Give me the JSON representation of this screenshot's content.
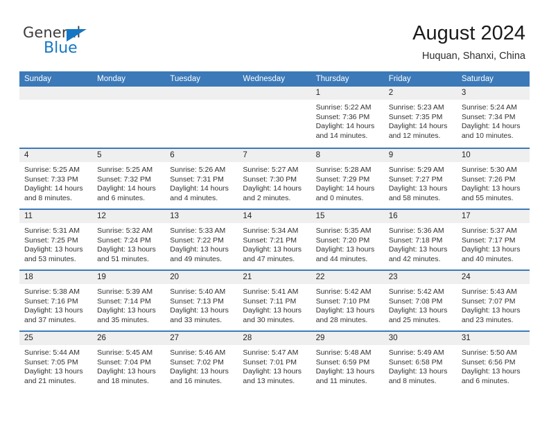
{
  "brand": {
    "name_top": "General",
    "name_bottom": "Blue",
    "triangle_color": "#1577c4"
  },
  "header": {
    "title": "August 2024",
    "location": "Huquan, Shanxi, China",
    "accent_color": "#3b79b8",
    "day_band_color": "#efefef"
  },
  "calendar": {
    "weekday_headers": [
      "Sunday",
      "Monday",
      "Tuesday",
      "Wednesday",
      "Thursday",
      "Friday",
      "Saturday"
    ],
    "labels": {
      "sunrise": "Sunrise:",
      "sunset": "Sunset:",
      "daylight": "Daylight:"
    },
    "weeks": [
      [
        {
          "day": "",
          "empty": true
        },
        {
          "day": "",
          "empty": true
        },
        {
          "day": "",
          "empty": true
        },
        {
          "day": "",
          "empty": true
        },
        {
          "day": "1",
          "sunrise": "Sunrise: 5:22 AM",
          "sunset": "Sunset: 7:36 PM",
          "daylight_l1": "Daylight: 14 hours",
          "daylight_l2": "and 14 minutes."
        },
        {
          "day": "2",
          "sunrise": "Sunrise: 5:23 AM",
          "sunset": "Sunset: 7:35 PM",
          "daylight_l1": "Daylight: 14 hours",
          "daylight_l2": "and 12 minutes."
        },
        {
          "day": "3",
          "sunrise": "Sunrise: 5:24 AM",
          "sunset": "Sunset: 7:34 PM",
          "daylight_l1": "Daylight: 14 hours",
          "daylight_l2": "and 10 minutes."
        }
      ],
      [
        {
          "day": "4",
          "sunrise": "Sunrise: 5:25 AM",
          "sunset": "Sunset: 7:33 PM",
          "daylight_l1": "Daylight: 14 hours",
          "daylight_l2": "and 8 minutes."
        },
        {
          "day": "5",
          "sunrise": "Sunrise: 5:25 AM",
          "sunset": "Sunset: 7:32 PM",
          "daylight_l1": "Daylight: 14 hours",
          "daylight_l2": "and 6 minutes."
        },
        {
          "day": "6",
          "sunrise": "Sunrise: 5:26 AM",
          "sunset": "Sunset: 7:31 PM",
          "daylight_l1": "Daylight: 14 hours",
          "daylight_l2": "and 4 minutes."
        },
        {
          "day": "7",
          "sunrise": "Sunrise: 5:27 AM",
          "sunset": "Sunset: 7:30 PM",
          "daylight_l1": "Daylight: 14 hours",
          "daylight_l2": "and 2 minutes."
        },
        {
          "day": "8",
          "sunrise": "Sunrise: 5:28 AM",
          "sunset": "Sunset: 7:29 PM",
          "daylight_l1": "Daylight: 14 hours",
          "daylight_l2": "and 0 minutes."
        },
        {
          "day": "9",
          "sunrise": "Sunrise: 5:29 AM",
          "sunset": "Sunset: 7:27 PM",
          "daylight_l1": "Daylight: 13 hours",
          "daylight_l2": "and 58 minutes."
        },
        {
          "day": "10",
          "sunrise": "Sunrise: 5:30 AM",
          "sunset": "Sunset: 7:26 PM",
          "daylight_l1": "Daylight: 13 hours",
          "daylight_l2": "and 55 minutes."
        }
      ],
      [
        {
          "day": "11",
          "sunrise": "Sunrise: 5:31 AM",
          "sunset": "Sunset: 7:25 PM",
          "daylight_l1": "Daylight: 13 hours",
          "daylight_l2": "and 53 minutes."
        },
        {
          "day": "12",
          "sunrise": "Sunrise: 5:32 AM",
          "sunset": "Sunset: 7:24 PM",
          "daylight_l1": "Daylight: 13 hours",
          "daylight_l2": "and 51 minutes."
        },
        {
          "day": "13",
          "sunrise": "Sunrise: 5:33 AM",
          "sunset": "Sunset: 7:22 PM",
          "daylight_l1": "Daylight: 13 hours",
          "daylight_l2": "and 49 minutes."
        },
        {
          "day": "14",
          "sunrise": "Sunrise: 5:34 AM",
          "sunset": "Sunset: 7:21 PM",
          "daylight_l1": "Daylight: 13 hours",
          "daylight_l2": "and 47 minutes."
        },
        {
          "day": "15",
          "sunrise": "Sunrise: 5:35 AM",
          "sunset": "Sunset: 7:20 PM",
          "daylight_l1": "Daylight: 13 hours",
          "daylight_l2": "and 44 minutes."
        },
        {
          "day": "16",
          "sunrise": "Sunrise: 5:36 AM",
          "sunset": "Sunset: 7:18 PM",
          "daylight_l1": "Daylight: 13 hours",
          "daylight_l2": "and 42 minutes."
        },
        {
          "day": "17",
          "sunrise": "Sunrise: 5:37 AM",
          "sunset": "Sunset: 7:17 PM",
          "daylight_l1": "Daylight: 13 hours",
          "daylight_l2": "and 40 minutes."
        }
      ],
      [
        {
          "day": "18",
          "sunrise": "Sunrise: 5:38 AM",
          "sunset": "Sunset: 7:16 PM",
          "daylight_l1": "Daylight: 13 hours",
          "daylight_l2": "and 37 minutes."
        },
        {
          "day": "19",
          "sunrise": "Sunrise: 5:39 AM",
          "sunset": "Sunset: 7:14 PM",
          "daylight_l1": "Daylight: 13 hours",
          "daylight_l2": "and 35 minutes."
        },
        {
          "day": "20",
          "sunrise": "Sunrise: 5:40 AM",
          "sunset": "Sunset: 7:13 PM",
          "daylight_l1": "Daylight: 13 hours",
          "daylight_l2": "and 33 minutes."
        },
        {
          "day": "21",
          "sunrise": "Sunrise: 5:41 AM",
          "sunset": "Sunset: 7:11 PM",
          "daylight_l1": "Daylight: 13 hours",
          "daylight_l2": "and 30 minutes."
        },
        {
          "day": "22",
          "sunrise": "Sunrise: 5:42 AM",
          "sunset": "Sunset: 7:10 PM",
          "daylight_l1": "Daylight: 13 hours",
          "daylight_l2": "and 28 minutes."
        },
        {
          "day": "23",
          "sunrise": "Sunrise: 5:42 AM",
          "sunset": "Sunset: 7:08 PM",
          "daylight_l1": "Daylight: 13 hours",
          "daylight_l2": "and 25 minutes."
        },
        {
          "day": "24",
          "sunrise": "Sunrise: 5:43 AM",
          "sunset": "Sunset: 7:07 PM",
          "daylight_l1": "Daylight: 13 hours",
          "daylight_l2": "and 23 minutes."
        }
      ],
      [
        {
          "day": "25",
          "sunrise": "Sunrise: 5:44 AM",
          "sunset": "Sunset: 7:05 PM",
          "daylight_l1": "Daylight: 13 hours",
          "daylight_l2": "and 21 minutes."
        },
        {
          "day": "26",
          "sunrise": "Sunrise: 5:45 AM",
          "sunset": "Sunset: 7:04 PM",
          "daylight_l1": "Daylight: 13 hours",
          "daylight_l2": "and 18 minutes."
        },
        {
          "day": "27",
          "sunrise": "Sunrise: 5:46 AM",
          "sunset": "Sunset: 7:02 PM",
          "daylight_l1": "Daylight: 13 hours",
          "daylight_l2": "and 16 minutes."
        },
        {
          "day": "28",
          "sunrise": "Sunrise: 5:47 AM",
          "sunset": "Sunset: 7:01 PM",
          "daylight_l1": "Daylight: 13 hours",
          "daylight_l2": "and 13 minutes."
        },
        {
          "day": "29",
          "sunrise": "Sunrise: 5:48 AM",
          "sunset": "Sunset: 6:59 PM",
          "daylight_l1": "Daylight: 13 hours",
          "daylight_l2": "and 11 minutes."
        },
        {
          "day": "30",
          "sunrise": "Sunrise: 5:49 AM",
          "sunset": "Sunset: 6:58 PM",
          "daylight_l1": "Daylight: 13 hours",
          "daylight_l2": "and 8 minutes."
        },
        {
          "day": "31",
          "sunrise": "Sunrise: 5:50 AM",
          "sunset": "Sunset: 6:56 PM",
          "daylight_l1": "Daylight: 13 hours",
          "daylight_l2": "and 6 minutes."
        }
      ]
    ]
  }
}
